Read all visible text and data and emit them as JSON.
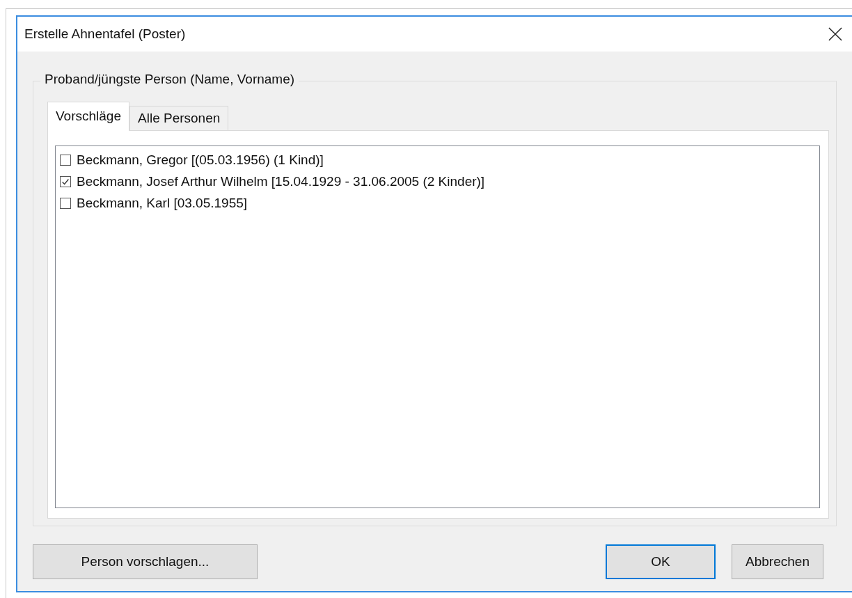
{
  "window": {
    "title": "Erstelle Ahnentafel (Poster)"
  },
  "group": {
    "label": "Proband/jüngste Person (Name, Vorname)"
  },
  "tabs": [
    {
      "label": "Vorschläge",
      "selected": true
    },
    {
      "label": "Alle Personen",
      "selected": false
    }
  ],
  "list": {
    "items": [
      {
        "label": "Beckmann, Gregor [(05.03.1956) (1 Kind)]",
        "checked": false
      },
      {
        "label": "Beckmann, Josef Arthur Wilhelm [15.04.1929 - 31.06.2005 (2 Kinder)]",
        "checked": true
      },
      {
        "label": "Beckmann, Karl [03.05.1955]",
        "checked": false
      }
    ]
  },
  "buttons": [
    {
      "label": "Person vorschlagen...",
      "default": false
    },
    {
      "label": "OK",
      "default": true
    },
    {
      "label": "Abbrechen",
      "default": false
    }
  ]
}
